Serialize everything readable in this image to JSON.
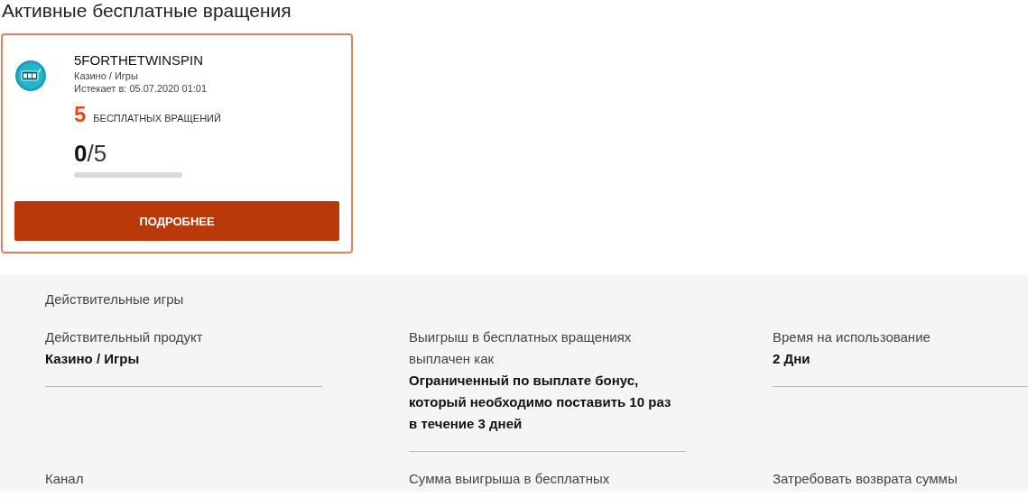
{
  "title": "Активные бесплатные вращения",
  "card": {
    "name": "5FORTHETWINSPIN",
    "category": "Казино / Игры",
    "expires": "Истекает в: 05.07.2020 01:01",
    "spins_count": "5",
    "spins_label": "БЕСПЛАТНЫХ ВРАЩЕНИЙ",
    "used": "0",
    "total": "/5",
    "level": 0,
    "button": "ПОДРОБНЕЕ"
  },
  "details": {
    "heading": "Действительные игры",
    "fields": [
      {
        "label": "Действительный продукт",
        "value": "Казино / Игры"
      },
      {
        "label": "Выигрыш в бесплатных вращениях выплачен как",
        "value": "Ограниченный по выплате бонус, который необходимо поставить 10 раз в течение 3 дней"
      },
      {
        "label": "Время на использование",
        "value": "2 Дни"
      },
      {
        "label": "Канал"
      },
      {
        "label": "Сумма выигрыша в бесплатных"
      },
      {
        "label": "Затребовать возврата суммы"
      }
    ]
  }
}
